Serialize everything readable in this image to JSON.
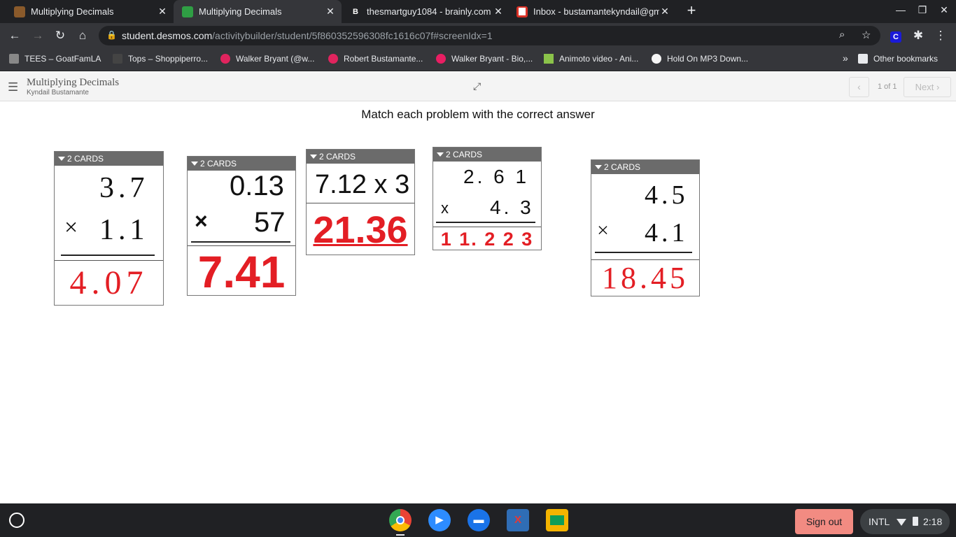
{
  "browser": {
    "tabs": [
      {
        "title": "Multiplying Decimals",
        "favicon": "desmos-cat-icon",
        "active": false
      },
      {
        "title": "Multiplying Decimals",
        "favicon": "desmos-activity-icon",
        "active": true
      },
      {
        "title": "thesmartguy1084 - brainly.com",
        "favicon": "brainly-icon",
        "active": false
      },
      {
        "title": "Inbox - bustamantekyndail@gm",
        "favicon": "gmail-icon",
        "active": false
      }
    ],
    "new_tab": "+",
    "url_host": "student.desmos.com",
    "url_path": "/activitybuilder/student/5f860352596308fc1616c07f#screenIdx=1",
    "extension_letter": "C",
    "bookmarks": [
      "TEES – GoatFamLA",
      "Tops – Shoppiperro...",
      "Walker Bryant (@w...",
      "Robert Bustamante...",
      "Walker Bryant - Bio,...",
      "Animoto video - Ani...",
      "Hold On MP3 Down...",
      "Other bookmarks"
    ],
    "more_bookmarks": "»"
  },
  "activity": {
    "title": "Multiplying Decimals",
    "student": "Kyndail Bustamante",
    "page_count": "1 of 1",
    "next_label": "Next",
    "instruction": "Match each problem with the correct answer"
  },
  "cards": [
    {
      "label": "2 CARDS",
      "top": "3.7",
      "op": "×",
      "bottom": "1.1",
      "answer": "4.07"
    },
    {
      "label": "2 CARDS",
      "top": "0.13",
      "op": "×",
      "bottom": "57",
      "answer": "7.41"
    },
    {
      "label": "2 CARDS",
      "top": "7.12 x 3",
      "op": "",
      "bottom": "",
      "answer": "21.36"
    },
    {
      "label": "2 CARDS",
      "top": "2. 6 1",
      "op": "x",
      "bottom": "4. 3",
      "answer": "1 1. 2 2 3"
    },
    {
      "label": "2 CARDS",
      "top": "4.5",
      "op": "×",
      "bottom": "4.1",
      "answer": "18.45"
    }
  ],
  "taskbar": {
    "sign_out": "Sign out",
    "input_method": "INTL",
    "time": "2:18",
    "apps": [
      "chrome-icon",
      "zoom-icon",
      "files-icon",
      "math-app-icon",
      "classroom-icon"
    ]
  }
}
